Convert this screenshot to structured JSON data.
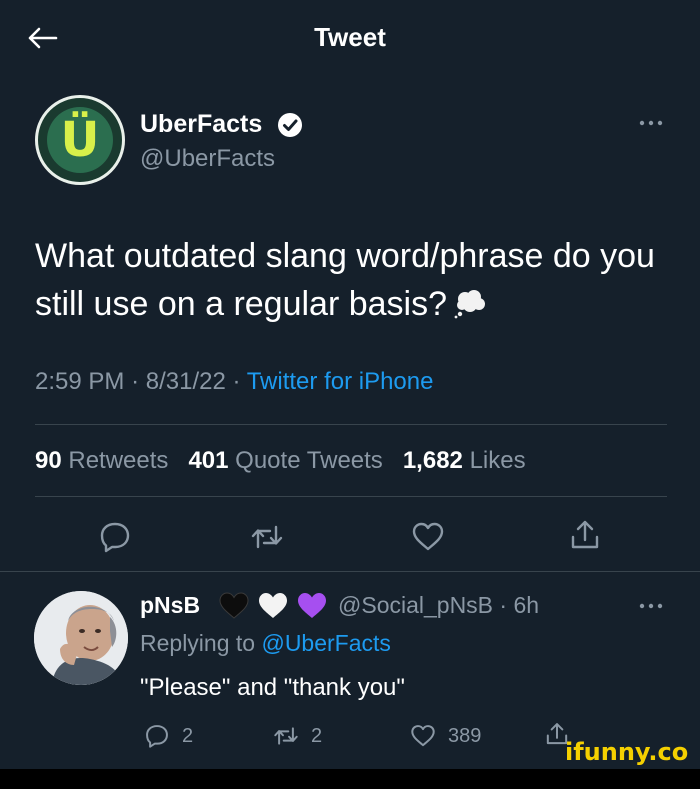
{
  "header": {
    "title": "Tweet"
  },
  "tweet": {
    "author_name": "UberFacts",
    "author_handle": "@UberFacts",
    "text": "What outdated slang word/phrase do you still use on a regular basis?",
    "time": "2:59 PM",
    "date": "8/31/22",
    "source": "Twitter for iPhone",
    "separator": "·",
    "retweets_count": "90",
    "retweets_label": "Retweets",
    "quote_count": "401",
    "quote_label": "Quote Tweets",
    "likes_count": "1,682",
    "likes_label": "Likes",
    "avatar_letter": "Ü"
  },
  "reply": {
    "author_name": "pNsB",
    "author_handle": "@Social_pNsB",
    "age": "6h",
    "replying_prefix": "Replying to",
    "replying_to": "@UberFacts",
    "text": "\"Please\" and \"thank you\"",
    "reply_count": "2",
    "retweet_count": "2",
    "like_count": "389"
  },
  "watermark": "ifunny.co",
  "colors": {
    "background": "#15202b",
    "accent": "#1d9bf0",
    "muted": "#8b98a5",
    "divider": "#38444d"
  }
}
